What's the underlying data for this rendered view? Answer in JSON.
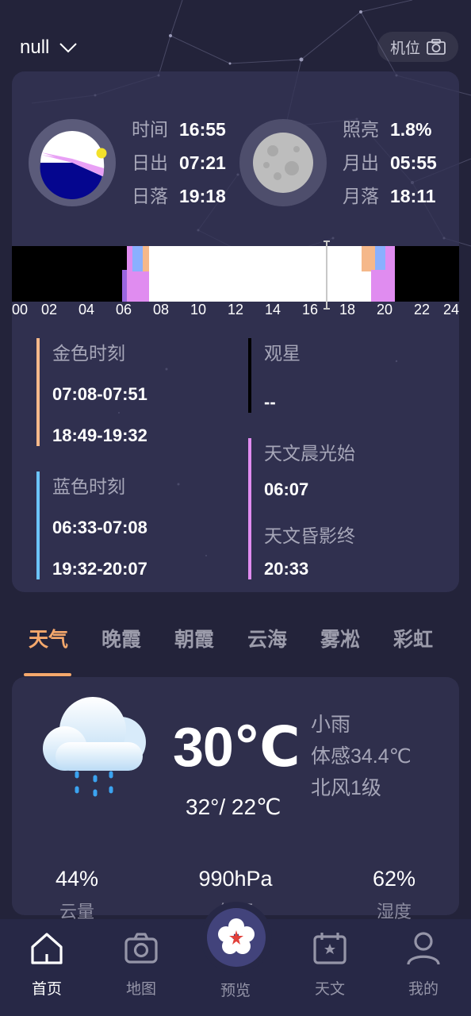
{
  "header": {
    "location": "null",
    "camera_label": "机位"
  },
  "sun": {
    "rows": [
      {
        "label": "时间",
        "value": "16:55"
      },
      {
        "label": "日出",
        "value": "07:21"
      },
      {
        "label": "日落",
        "value": "19:18"
      }
    ]
  },
  "moon": {
    "rows": [
      {
        "label": "照亮",
        "value": "1.8%"
      },
      {
        "label": "月出",
        "value": "05:55"
      },
      {
        "label": "月落",
        "value": "18:11"
      }
    ]
  },
  "timeline": {
    "hour_labels": [
      "00",
      "02",
      "04",
      "06",
      "08",
      "10",
      "12",
      "14",
      "16",
      "18",
      "20",
      "22",
      "24"
    ],
    "current_time_hours": 16.92
  },
  "periods": {
    "golden": {
      "title": "金色时刻",
      "values": [
        "07:08-07:51",
        "18:49-19:32"
      ]
    },
    "blue": {
      "title": "蓝色时刻",
      "values": [
        "06:33-07:08",
        "19:32-20:07"
      ]
    },
    "stargazing": {
      "title": "观星",
      "value": "--"
    },
    "astro_dawn": {
      "title": "天文晨光始",
      "value": "06:07"
    },
    "astro_dusk": {
      "title": "天文昏影终",
      "value": "20:33"
    }
  },
  "tabs": [
    "天气",
    "晚霞",
    "朝霞",
    "云海",
    "雾凇",
    "彩虹"
  ],
  "weather": {
    "temp": "30℃",
    "range": "32°/ 22℃",
    "condition": "小雨",
    "feels_like": "体感34.4℃",
    "wind": "北风1级",
    "stats": [
      {
        "value": "44%",
        "label": "云量"
      },
      {
        "value": "990hPa",
        "label": "气压"
      },
      {
        "value": "62%",
        "label": "湿度"
      }
    ]
  },
  "nav": [
    {
      "label": "首页",
      "icon": "home-icon"
    },
    {
      "label": "地图",
      "icon": "camera-icon"
    },
    {
      "label": "预览",
      "icon": "flower-icon"
    },
    {
      "label": "天文",
      "icon": "calendar-icon"
    },
    {
      "label": "我的",
      "icon": "user-icon"
    }
  ],
  "colors": {
    "accent": "#f5a86c",
    "golden": "#f5b88a",
    "blue": "#6cc4ff",
    "astro": "#e08cf0",
    "background": "#23233a",
    "card": "#343456"
  }
}
